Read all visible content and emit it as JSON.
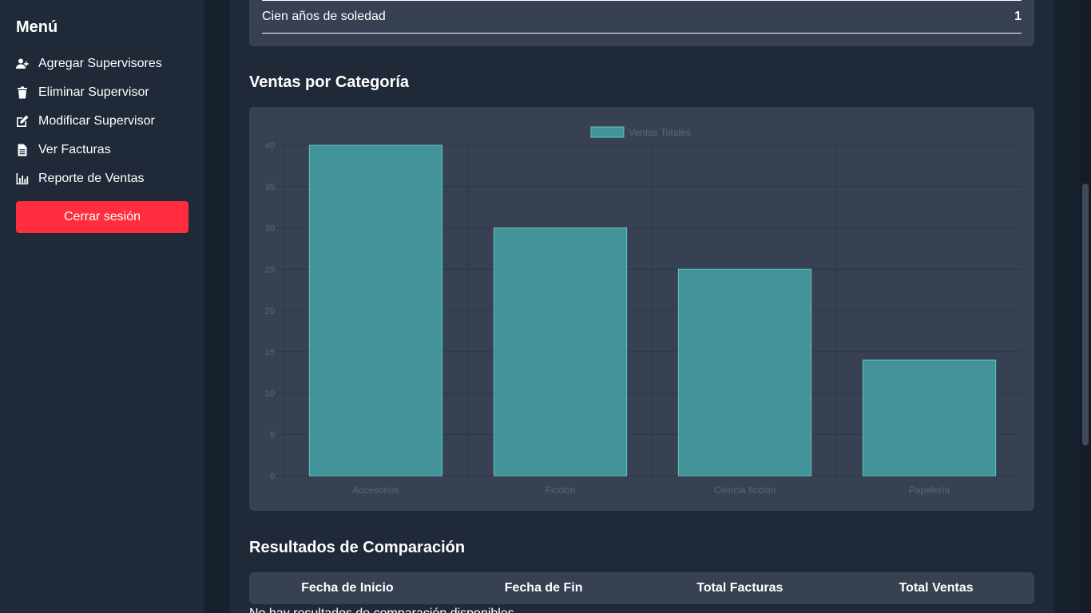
{
  "sidebar": {
    "title": "Menú",
    "items": [
      {
        "label": "Agregar Supervisores",
        "icon": "user-plus-icon"
      },
      {
        "label": "Eliminar Supervisor",
        "icon": "trash-icon"
      },
      {
        "label": "Modificar Supervisor",
        "icon": "edit-icon"
      },
      {
        "label": "Ver Facturas",
        "icon": "file-text-icon"
      },
      {
        "label": "Reporte de Ventas",
        "icon": "bar-chart-icon"
      }
    ],
    "logout_label": "Cerrar sesión",
    "logout_color": "#ff2d3d"
  },
  "top_table": {
    "row": {
      "title": "Cien años de soledad",
      "quantity": "1"
    }
  },
  "sales_section": {
    "title": "Ventas por Categoría"
  },
  "chart_data": {
    "type": "bar",
    "categories": [
      "Accesorios",
      "Ficción",
      "Ciencia ficción",
      "Papelería"
    ],
    "series": [
      {
        "name": "Ventas Totales",
        "values": [
          40,
          30,
          25,
          14
        ],
        "color": "#44a3a6"
      }
    ],
    "ylim": [
      0,
      40
    ],
    "yticks": [
      0,
      5,
      10,
      15,
      20,
      25,
      30,
      35,
      40
    ],
    "grid": true,
    "legend": "top-center"
  },
  "comparison_section": {
    "title": "Resultados de Comparación",
    "columns": [
      "Fecha de Inicio",
      "Fecha de Fin",
      "Total Facturas",
      "Total Ventas"
    ],
    "empty_message": "No hay resultados de comparación disponibles"
  }
}
